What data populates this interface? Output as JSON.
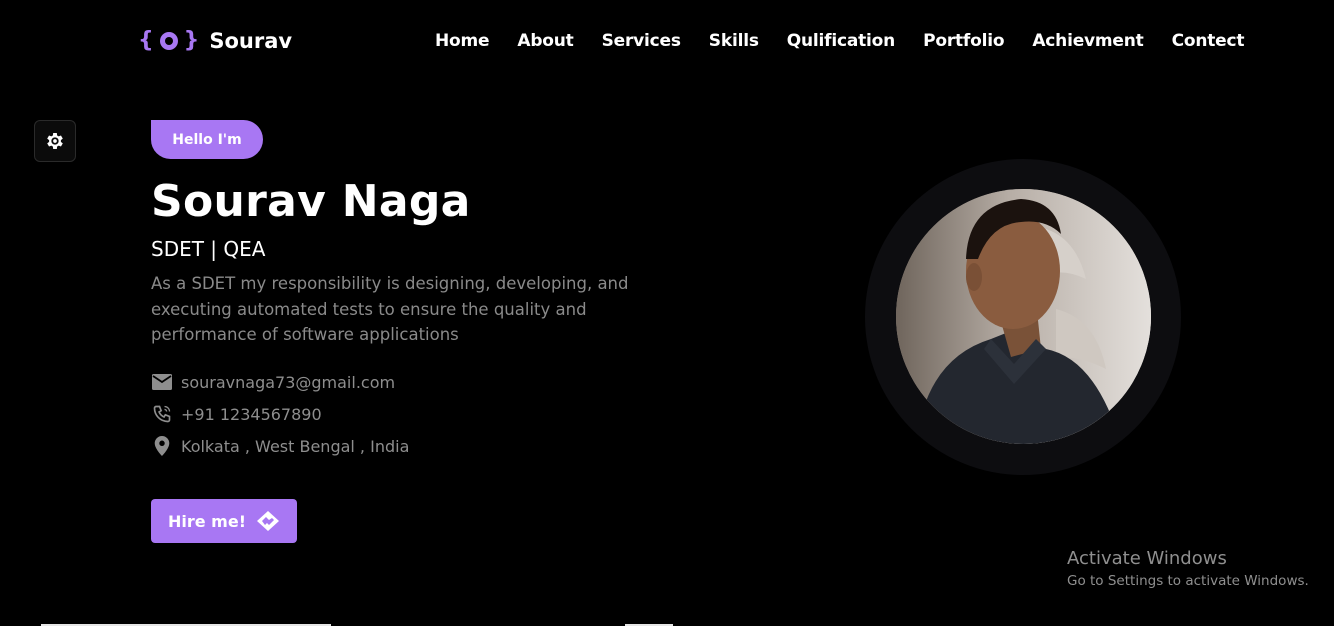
{
  "header": {
    "logo_left_brace": "{",
    "logo_right_brace": "}",
    "logo_text": "Sourav",
    "nav": [
      "Home",
      "About",
      "Services",
      "Skills",
      "Qulification",
      "Portfolio",
      "Achievment",
      "Contect"
    ]
  },
  "hero": {
    "greeting": "Hello I'm",
    "name": "Sourav Naga",
    "role": "SDET | QEA",
    "description": "As a SDET my responsibility is designing, developing, and executing automated tests to ensure the quality and performance of software applications",
    "email": "souravnaga73@gmail.com",
    "phone": "+91 1234567890",
    "location": "Kolkata , West Bengal , India",
    "cta_label": "Hire me!"
  },
  "watermark": {
    "title": "Activate Windows",
    "subtitle": "Go to Settings to activate Windows."
  },
  "colors": {
    "accent": "#a877f3",
    "background": "#000000",
    "muted_text": "#8a8a8a"
  },
  "icons": {
    "settings": "gear-icon",
    "email": "mail-icon",
    "phone": "phone-icon",
    "location": "location-pin-icon",
    "cta": "handshake-icon",
    "logo": "logo-head-icon"
  }
}
